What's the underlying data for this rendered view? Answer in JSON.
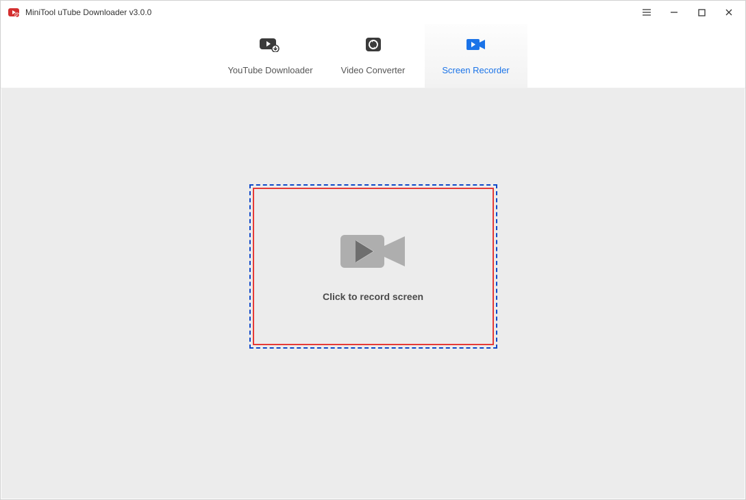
{
  "titlebar": {
    "title": "MiniTool uTube Downloader v3.0.0"
  },
  "tabs": {
    "youtube": "YouTube Downloader",
    "converter": "Video Converter",
    "recorder": "Screen Recorder"
  },
  "main": {
    "record_label": "Click to record screen"
  },
  "colors": {
    "accent": "#1a73e8",
    "dash_border": "#0d47c8",
    "solid_border": "#e53935"
  }
}
